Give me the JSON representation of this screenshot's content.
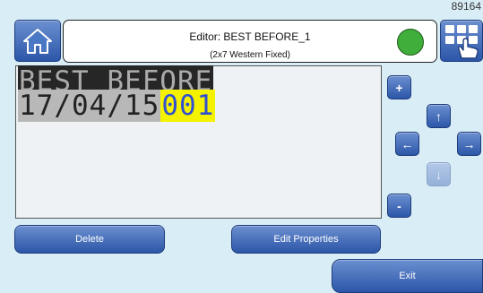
{
  "corner_code": "89164",
  "header": {
    "title": "Editor: BEST BEFORE_1",
    "subtitle": "(2x7 Western Fixed)",
    "status_color": "#3fae3a"
  },
  "editor": {
    "line1": "BEST BEFORE",
    "line2_a": "17/04/15",
    "line2_b": "001"
  },
  "controls": {
    "plus": "+",
    "minus": "-",
    "up": "↑",
    "down": "↓",
    "left": "←",
    "right": "→"
  },
  "buttons": {
    "delete": "Delete",
    "edit_properties": "Edit Properties",
    "exit": "Exit"
  },
  "icons": [
    "home-icon",
    "keypad-icon",
    "hand-pointer-icon",
    "status-indicator"
  ]
}
